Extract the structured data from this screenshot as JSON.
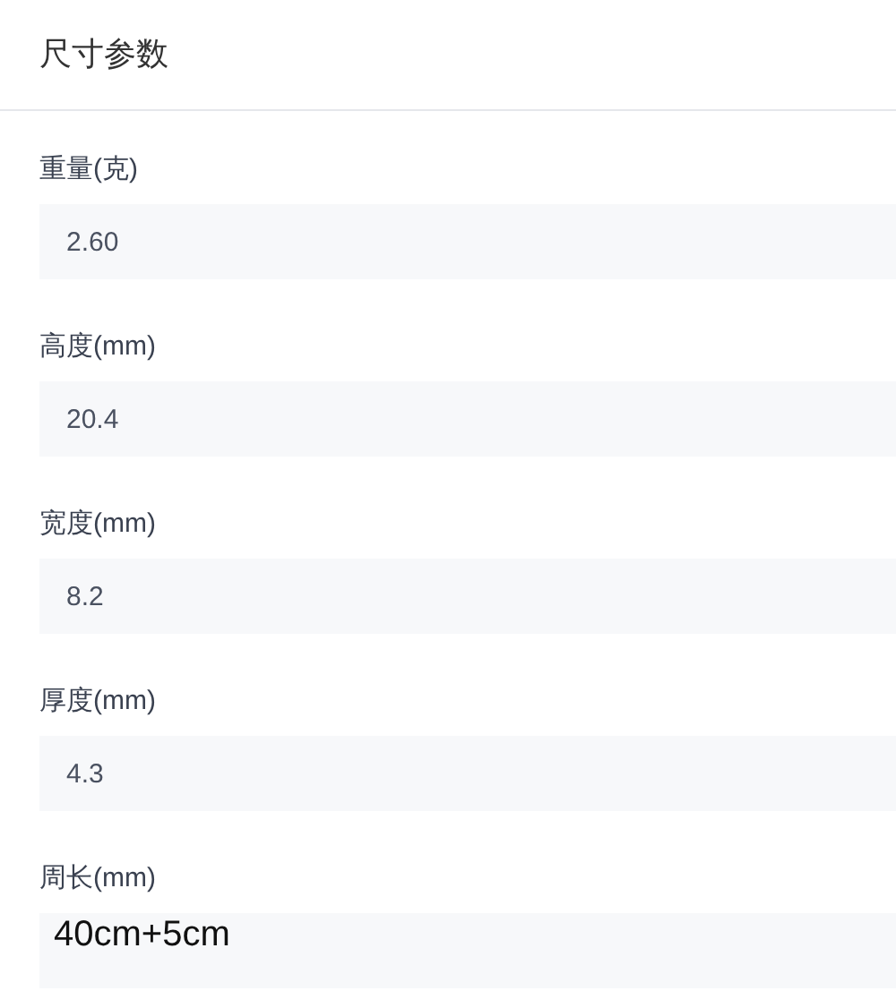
{
  "section": {
    "title": "尺寸参数"
  },
  "fields": [
    {
      "label": "重量(克)",
      "value": "2.60",
      "kind": "input"
    },
    {
      "label": "高度(mm)",
      "value": "20.4",
      "kind": "input"
    },
    {
      "label": "宽度(mm)",
      "value": "8.2",
      "kind": "input"
    },
    {
      "label": "厚度(mm)",
      "value": "4.3",
      "kind": "input"
    },
    {
      "label": "周长(mm)",
      "value": "40cm+5cm",
      "kind": "textarea"
    }
  ]
}
